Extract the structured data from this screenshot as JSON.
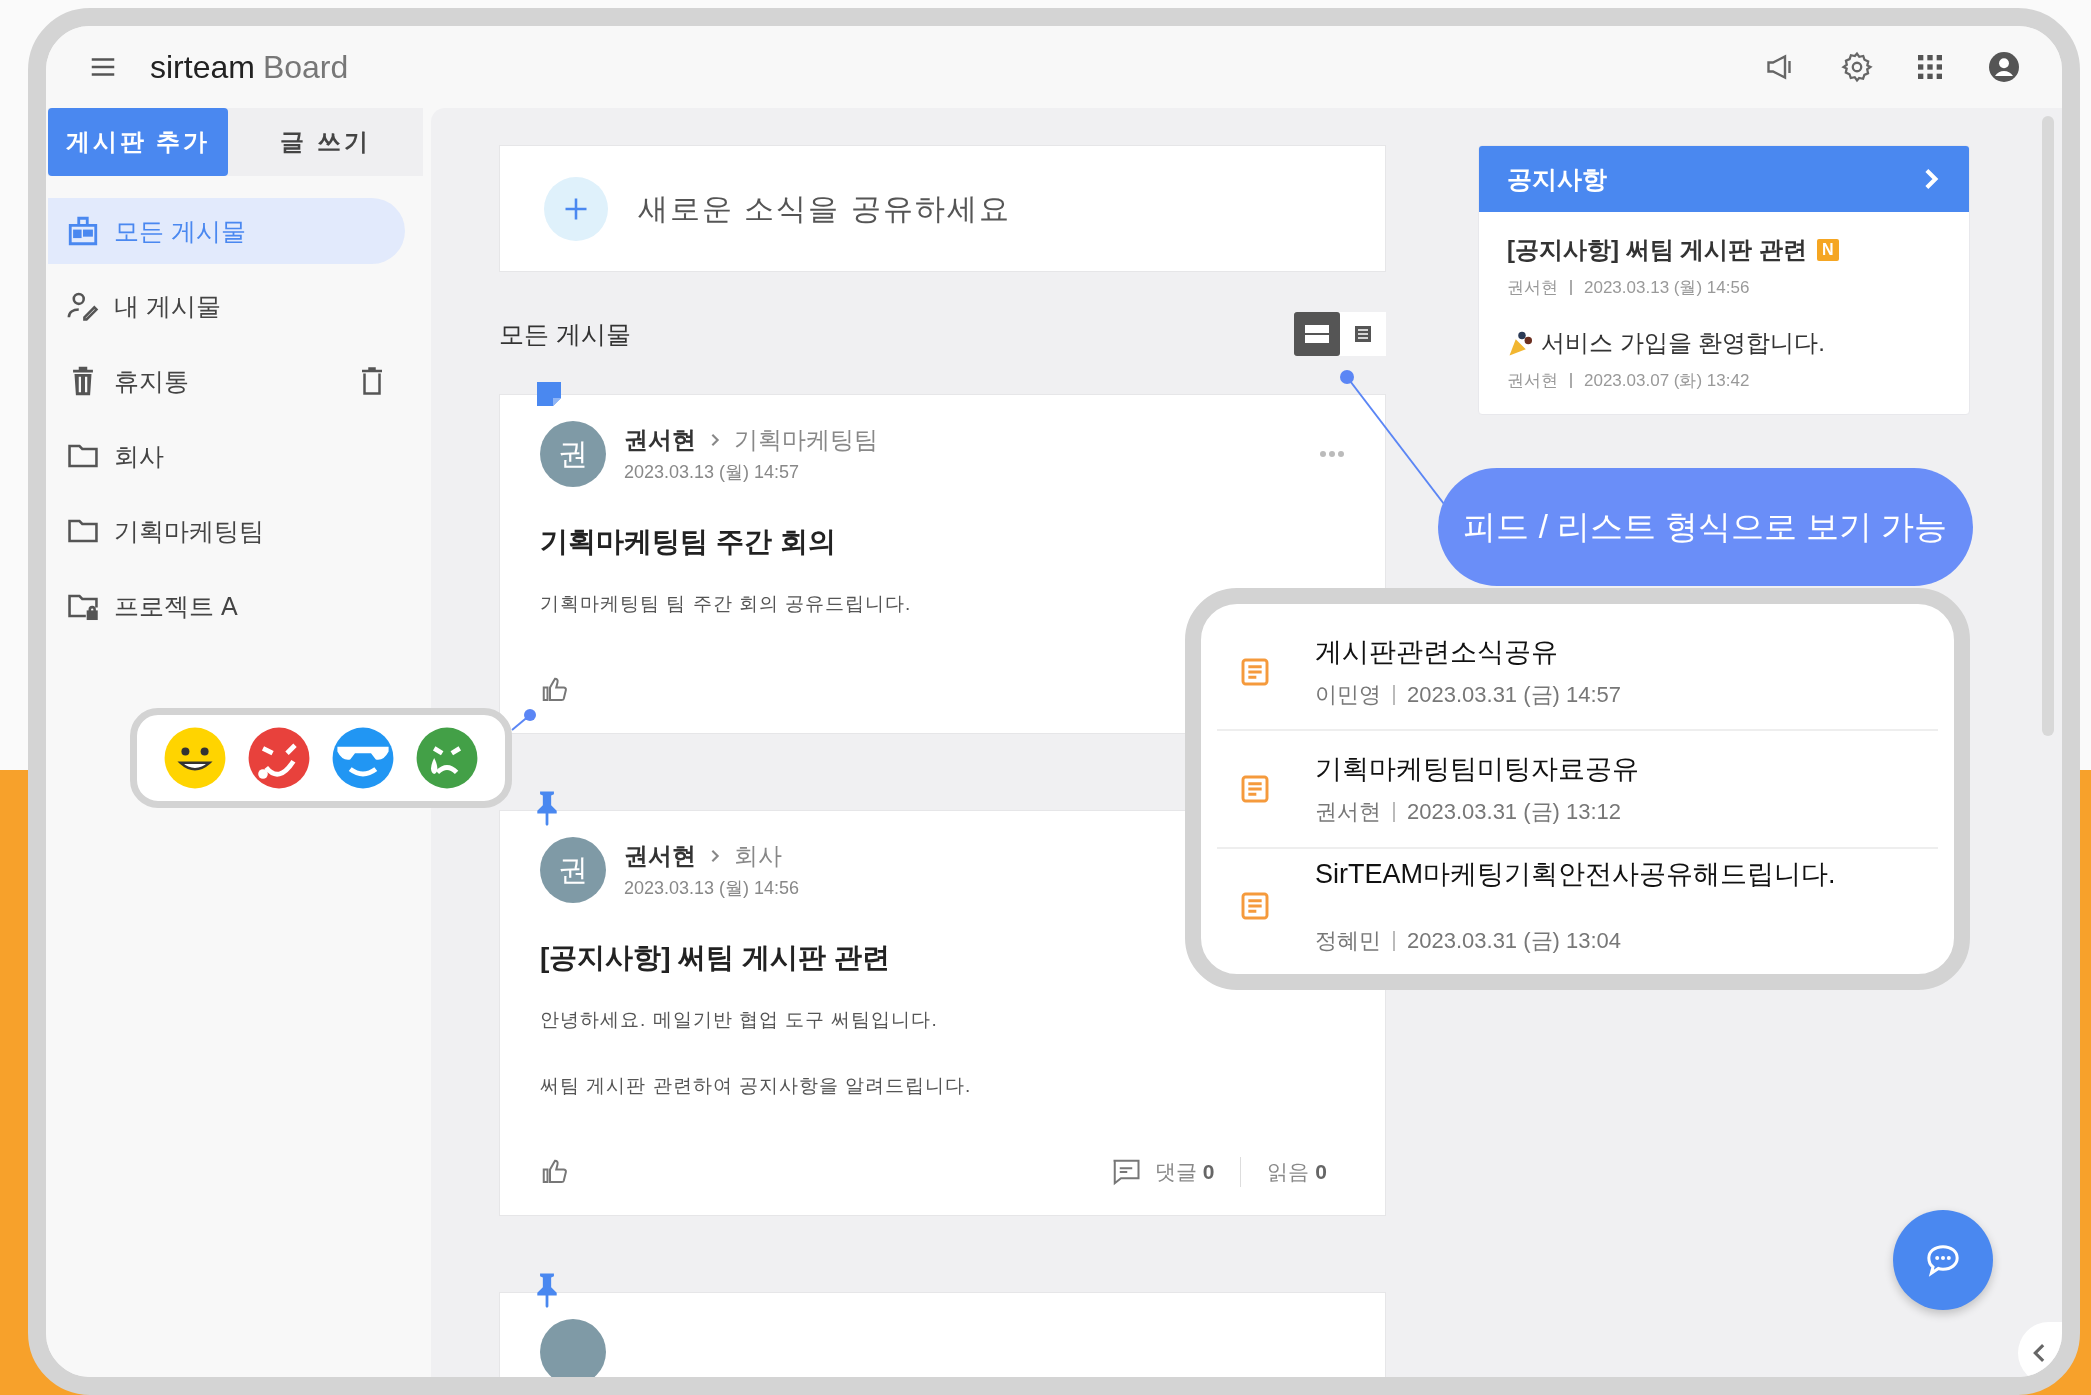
{
  "app": {
    "brand_bold": "sirteam",
    "brand_light": "Board"
  },
  "sidebar": {
    "buttons": [
      {
        "label": "게시판 추가",
        "selected": true
      },
      {
        "label": "글 쓰기",
        "selected": false
      }
    ],
    "items": [
      {
        "label": "모든 게시물",
        "kind": "all",
        "selected": true
      },
      {
        "label": "내 게시물",
        "kind": "mine",
        "selected": false
      },
      {
        "label": "휴지통",
        "kind": "trash",
        "selected": false
      },
      {
        "label": "회사",
        "kind": "folder",
        "selected": false
      },
      {
        "label": "기획마케팅팀",
        "kind": "folder",
        "selected": false
      },
      {
        "label": "프로젝트 A",
        "kind": "locked",
        "selected": false
      }
    ]
  },
  "compose": {
    "placeholder": "새로운 소식을 공유하세요"
  },
  "feed": {
    "title": "모든 게시물",
    "view_modes": [
      {
        "kind": "feed",
        "selected": true
      },
      {
        "kind": "list",
        "selected": false
      }
    ]
  },
  "posts": [
    {
      "kind": "note",
      "avatar": "권",
      "author": "권서현",
      "board": "기획마케팅팀",
      "date": "2023.03.13 (월) 14:57",
      "title": "기획마케팅팀 주간 회의",
      "body": [
        "기획마케팅팀 팀 주간 회의 공유드립니다."
      ]
    },
    {
      "kind": "pin",
      "avatar": "권",
      "author": "권서현",
      "board": "회사",
      "date": "2023.03.13 (월) 14:56",
      "title": "[공지사항] 써팀 게시판 관련",
      "body": [
        "안녕하세요. 메일기반 협업 도구 써팀입니다.",
        "써팀 게시판 관련하여 공지사항을 알려드립니다."
      ],
      "comments_label": "댓글",
      "comments": "0",
      "reads_label": "읽음",
      "reads": "0"
    },
    {
      "kind": "pin"
    }
  ],
  "notices": {
    "title": "공지사항",
    "items": [
      {
        "title": "[공지사항] 써팀 게시판 관련",
        "badge": "N",
        "author": "권서현",
        "date": "2023.03.13 (월) 14:56"
      },
      {
        "title": "서비스 가입을 환영합니다.",
        "leading_icon": true,
        "author": "권서현",
        "date": "2023.03.07 (화) 13:42"
      }
    ]
  },
  "callout": {
    "text": "피드 / 리스트 형식으로 보기 가능"
  },
  "list_preview": [
    {
      "title": "게시판관련소식공유",
      "author": "이민영",
      "date": "2023.03.31 (금) 14:57"
    },
    {
      "title": "기획마케팅팀미팅자료공유",
      "author": "권서현",
      "date": "2023.03.31 (금) 13:12"
    },
    {
      "title": "SirTEAM마케팅기획안전사공유해드립니다.",
      "author": "정혜민",
      "date": "2023.03.31 (금) 13:04"
    }
  ],
  "reactions": [
    {
      "kind": "smile",
      "color": "#ffd400"
    },
    {
      "kind": "laugh",
      "color": "#e8413c"
    },
    {
      "kind": "cool",
      "color": "#2196f3"
    },
    {
      "kind": "cry",
      "color": "#43a047"
    }
  ]
}
